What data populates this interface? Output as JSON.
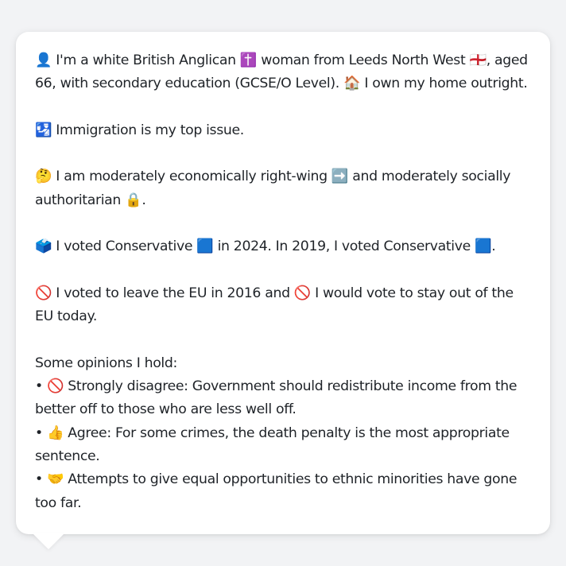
{
  "message": {
    "identity": "👤 I'm a white British Anglican ✝️ woman from Leeds North West 🏴󠁧󠁢󠁥󠁮󠁧󠁿, aged 66, with secondary education (GCSE/O Level). 🏠 I own my home outright.",
    "top_issue": "🛂 Immigration is my top issue.",
    "ideology": "🤔 I am moderately economically right-wing ➡️ and moderately socially authoritarian 🔒.",
    "votes": "🗳️ I voted Conservative 🟦 in 2024. In 2019, I voted Conservative 🟦.",
    "eu": "🚫 I voted to leave the EU in 2016 and 🚫 I would vote to stay out of the EU today.",
    "opinions_heading": "Some opinions I hold:",
    "opinions": [
      "• 🚫 Strongly disagree: Government should redistribute income from the better off to those who are less well off.",
      "• 👍 Agree: For some crimes, the death penalty is the most appropriate sentence.",
      "• 🤝 Attempts to give equal opportunities to ethnic minorities have gone too far."
    ]
  }
}
